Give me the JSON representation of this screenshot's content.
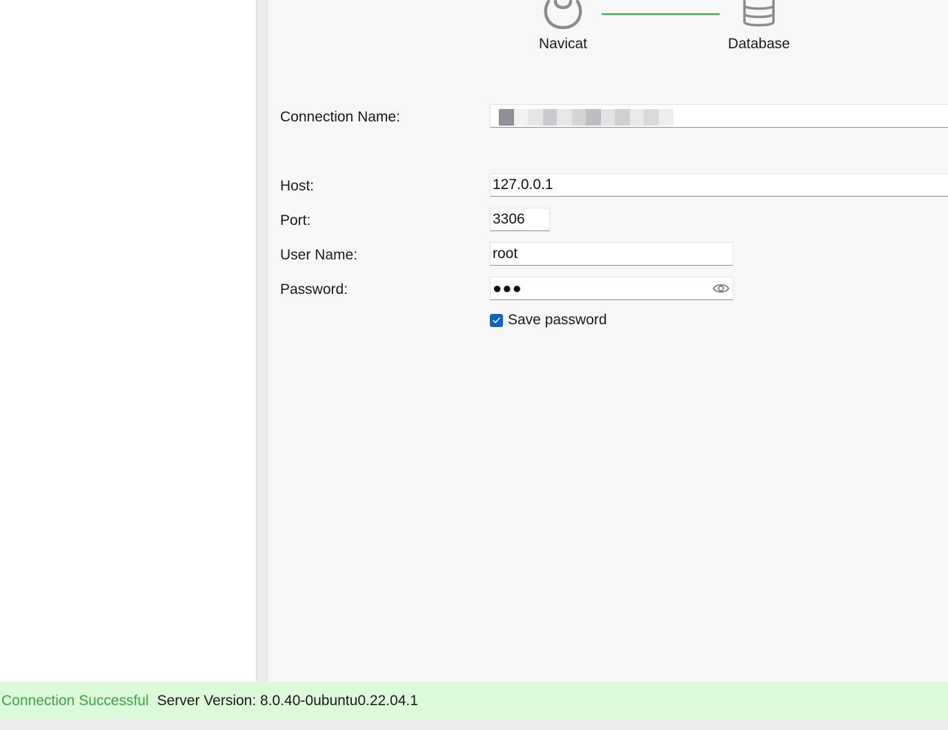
{
  "diagram": {
    "source_label": "Navicat",
    "target_label": "Database",
    "source_icon": "navicat-icon",
    "target_icon": "database-icon",
    "link_color": "#4cc35a"
  },
  "form": {
    "connection_name_label": "Connection Name:",
    "host_label": "Host:",
    "host_value": "127.0.0.1",
    "port_label": "Port:",
    "port_value": "3306",
    "username_label": "User Name:",
    "username_value": "root",
    "password_label": "Password:",
    "password_mask": "●●●",
    "save_password_label": "Save password",
    "save_password_checked": true
  },
  "status": {
    "result": "Connection Successful",
    "server_version": "Server Version: 8.0.40-0ubuntu0.22.04.1",
    "success_color": "#3aa741",
    "bar_color": "#dcf9da"
  }
}
